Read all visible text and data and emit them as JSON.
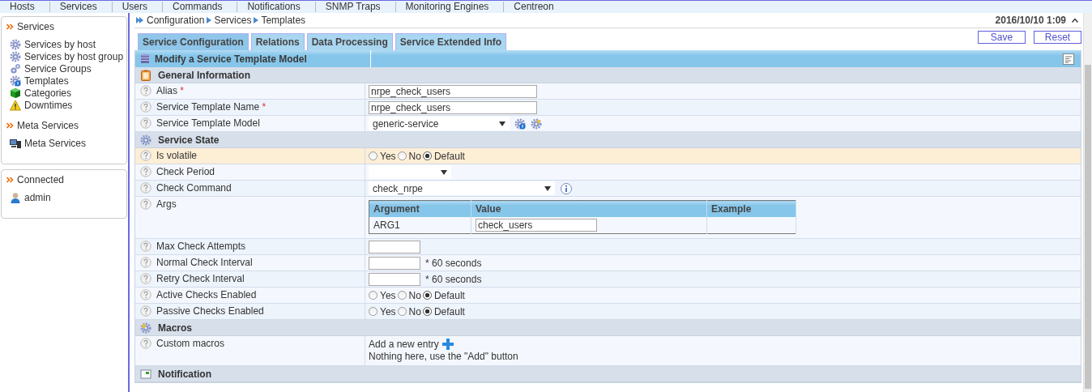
{
  "top_menu": [
    {
      "label": "Hosts"
    },
    {
      "label": "Services"
    },
    {
      "label": "Users"
    },
    {
      "label": "Commands"
    },
    {
      "label": "Notifications"
    },
    {
      "label": "SNMP Traps"
    },
    {
      "label": "Monitoring Engines"
    },
    {
      "label": "Centreon"
    }
  ],
  "sidebar": {
    "panels": [
      {
        "groups": [
          {
            "title": "Services",
            "items": [
              {
                "label": "Services by host"
              },
              {
                "label": "Services by host group"
              },
              {
                "label": "Service Groups"
              },
              {
                "label": "Templates"
              },
              {
                "label": "Categories"
              },
              {
                "label": "Downtimes"
              }
            ]
          },
          {
            "title": "Meta Services",
            "items": [
              {
                "label": "Meta Services"
              }
            ]
          }
        ]
      },
      {
        "groups": [
          {
            "title": "Connected",
            "items": [
              {
                "label": "admin"
              }
            ]
          }
        ]
      }
    ]
  },
  "breadcrumb": [
    "Configuration",
    "Services",
    "Templates"
  ],
  "datetime": "2016/10/10 1:09",
  "tabs": [
    {
      "label": "Service Configuration",
      "selected": true
    },
    {
      "label": "Relations",
      "selected": false
    },
    {
      "label": "Data Processing",
      "selected": false
    },
    {
      "label": "Service Extended Info",
      "selected": false
    }
  ],
  "buttons": [
    "Save",
    "Reset"
  ],
  "form": {
    "title": "Modify a Service Template Model",
    "sections": [
      {
        "title": "General Information",
        "rows": [
          {
            "label": "Alias",
            "required_mark": "*",
            "kind": "text",
            "value": "nrpe_check_users",
            "highlighted": false
          },
          {
            "label": "Service Template Name",
            "required_mark": "*",
            "kind": "text",
            "value": "nrpe_check_users",
            "highlighted": false
          },
          {
            "label": "Service Template Model",
            "kind": "template",
            "value": "generic-service",
            "highlighted": false
          }
        ]
      },
      {
        "title": "Service State",
        "rows": [
          {
            "label": "Is volatile",
            "kind": "radio",
            "highlighted": true,
            "options": [
              {
                "label": "Yes",
                "selected": false
              },
              {
                "label": "No",
                "selected": false
              },
              {
                "label": "Default",
                "selected": true
              }
            ]
          },
          {
            "label": "Check Period",
            "kind": "select",
            "highlighted": false
          },
          {
            "label": "Check Command",
            "kind": "command",
            "value": "check_nrpe",
            "highlighted": false
          },
          {
            "label": "Args",
            "kind": "args",
            "highlighted": false,
            "columns": [
              "Argument",
              "Value",
              "Example"
            ],
            "args": [
              {
                "name": "ARG1",
                "value": "check_users"
              }
            ]
          },
          {
            "label": "Max Check Attempts",
            "kind": "number",
            "highlighted": false
          },
          {
            "label": "Normal Check Interval",
            "kind": "number",
            "suffix": "* 60 seconds",
            "highlighted": false
          },
          {
            "label": "Retry Check Interval",
            "kind": "number",
            "suffix": "* 60 seconds",
            "highlighted": false
          },
          {
            "label": "Active Checks Enabled",
            "kind": "radio",
            "highlighted": false,
            "options": [
              {
                "label": "Yes",
                "selected": false
              },
              {
                "label": "No",
                "selected": false
              },
              {
                "label": "Default",
                "selected": true
              }
            ]
          },
          {
            "label": "Passive Checks Enabled",
            "kind": "radio",
            "highlighted": false,
            "options": [
              {
                "label": "Yes",
                "selected": false
              },
              {
                "label": "No",
                "selected": false
              },
              {
                "label": "Default",
                "selected": true
              }
            ]
          }
        ]
      },
      {
        "title": "Macros",
        "rows": [
          {
            "label": "Custom macros",
            "kind": "macros",
            "add_label": "Add a new entry",
            "empty_text": "Nothing here, use the \"Add\" button",
            "highlighted": false
          }
        ]
      },
      {
        "title": "Notification"
      }
    ]
  }
}
